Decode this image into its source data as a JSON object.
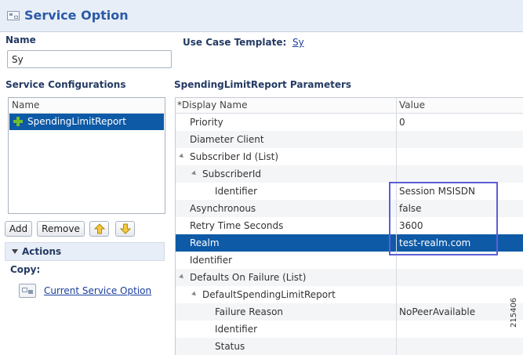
{
  "window": {
    "title": "Service Option",
    "icon": "service-option-icon"
  },
  "name_section": {
    "label": "Name",
    "value": "Sy"
  },
  "use_case_template": {
    "label": "Use Case Template:",
    "link": "Sy"
  },
  "service_configurations": {
    "label": "Service Configurations",
    "list_header": "Name",
    "items": [
      {
        "label": "SpendingLimitReport",
        "icon": "plus-icon",
        "selected": true
      }
    ],
    "buttons": {
      "add": "Add",
      "remove": "Remove",
      "move_up": "arrow-up-icon",
      "move_down": "arrow-down-icon"
    }
  },
  "actions": {
    "label": "Actions",
    "copy_label": "Copy:",
    "copy_link": "Current Service Option",
    "copy_icon": "copy-icon"
  },
  "parameters": {
    "title": "SpendingLimitReport Parameters",
    "columns": {
      "name": "*Display Name",
      "value": "Value"
    },
    "rows": [
      {
        "name": "Priority",
        "value": "0",
        "level": 0
      },
      {
        "name": "Diameter Client",
        "value": "",
        "level": 0
      },
      {
        "name": "Subscriber Id (List)",
        "value": "",
        "level": 0,
        "expanded": true
      },
      {
        "name": "SubscriberId",
        "value": "",
        "level": 1,
        "expanded": true
      },
      {
        "name": "Identifier",
        "value": "Session MSISDN",
        "level": 2
      },
      {
        "name": "Asynchronous",
        "value": "false",
        "level": 0
      },
      {
        "name": "Retry Time Seconds",
        "value": "3600",
        "level": 0
      },
      {
        "name": "Realm",
        "value": "test-realm.com",
        "level": 0,
        "selected": true
      },
      {
        "name": "Identifier",
        "value": "",
        "level": 0
      },
      {
        "name": "Defaults On Failure (List)",
        "value": "",
        "level": 0,
        "expanded": true
      },
      {
        "name": "DefaultSpendingLimitReport",
        "value": "",
        "level": 1,
        "expanded": true
      },
      {
        "name": "Failure Reason",
        "value": "NoPeerAvailable",
        "level": 2
      },
      {
        "name": "Identifier",
        "value": "",
        "level": 2
      },
      {
        "name": "Status",
        "value": "",
        "level": 2
      }
    ],
    "highlight_color": "#5b5fd6",
    "selection_color": "#0e5aa7"
  },
  "figure_number": "215406"
}
